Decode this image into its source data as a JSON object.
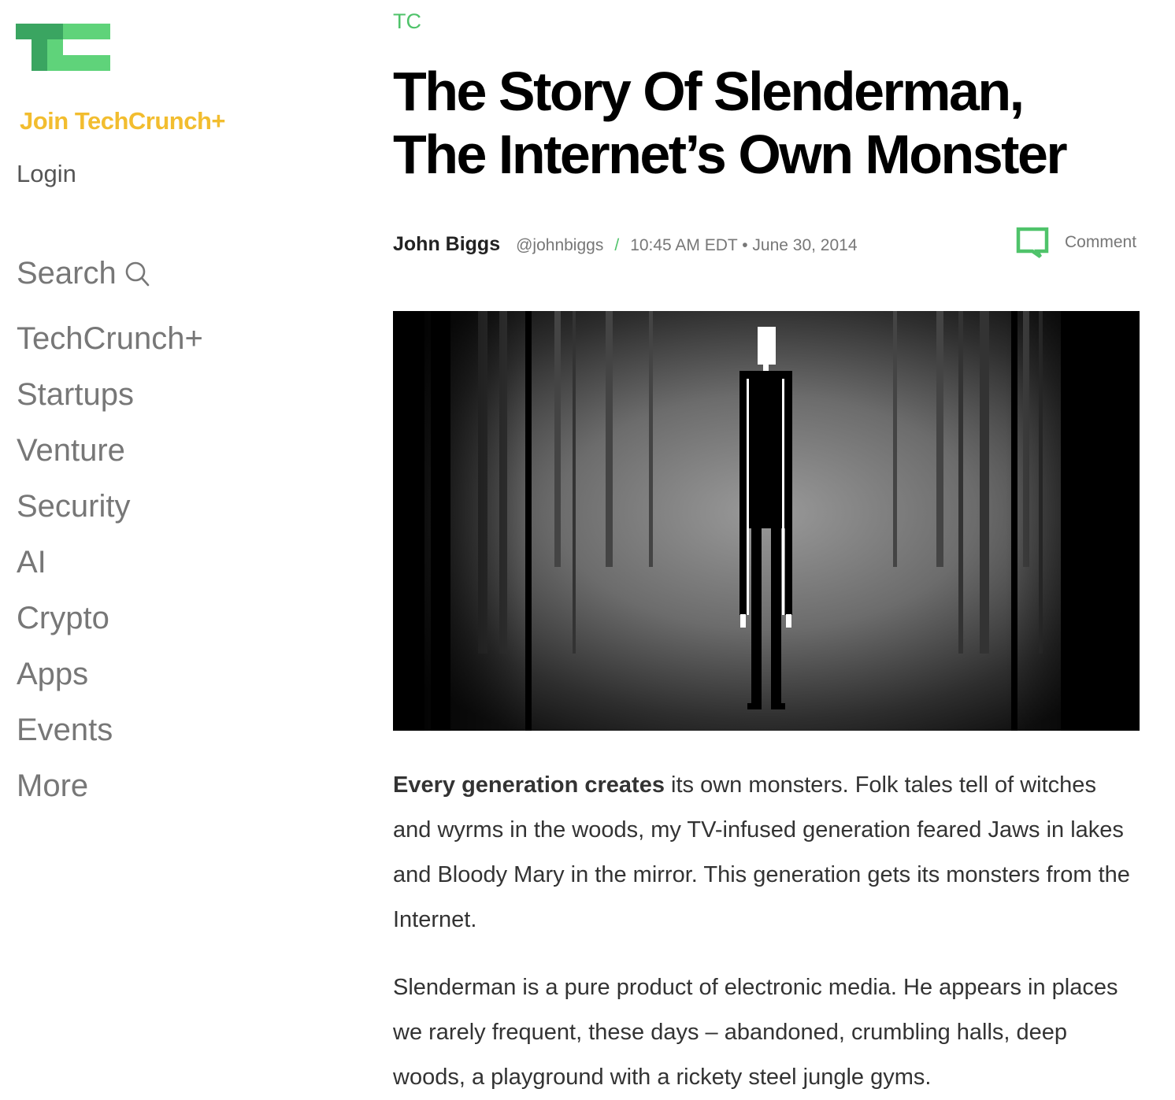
{
  "sidebar": {
    "logo_icon": "techcrunch-tc-logo",
    "join_label": "Join TechCrunch+",
    "login_label": "Login",
    "search_label": "Search",
    "search_icon": "search-icon",
    "nav": [
      {
        "label": "TechCrunch+"
      },
      {
        "label": "Startups"
      },
      {
        "label": "Venture"
      },
      {
        "label": "Security"
      },
      {
        "label": "AI"
      },
      {
        "label": "Crypto"
      },
      {
        "label": "Apps"
      },
      {
        "label": "Events"
      },
      {
        "label": "More"
      }
    ]
  },
  "article": {
    "kicker": "TC",
    "headline_line1": "The Story Of Slenderman,",
    "headline_line2": "The Internet’s Own Monster",
    "author": "John Biggs",
    "handle": "@johnbiggs",
    "separator": "/",
    "timestamp": "10:45 AM EDT • June 30, 2014",
    "comment_label": "Comment",
    "comment_icon": "comment-bubble-icon",
    "hero_image": "slenderman-pixel-art-in-dark-forest",
    "p1_lead": "Every generation creates",
    "p1_rest": " its own monsters. Folk tales tell of witches and wyrms in the woods, my TV-infused generation feared Jaws in lakes and Bloody Mary in the mirror. This generation gets its monsters from the Internet.",
    "p2": "Slenderman is a pure product of electronic media. He appears in places we rarely frequent, these days – abandoned, crumbling halls, deep woods, a playground with a rickety steel jungle gyms."
  },
  "colors": {
    "brand_green": "#4fc36a",
    "logo_dark_green": "#3aa561",
    "logo_light_green": "#5fd37a",
    "join_yellow": "#f2bd2f",
    "nav_gray": "#777777"
  }
}
